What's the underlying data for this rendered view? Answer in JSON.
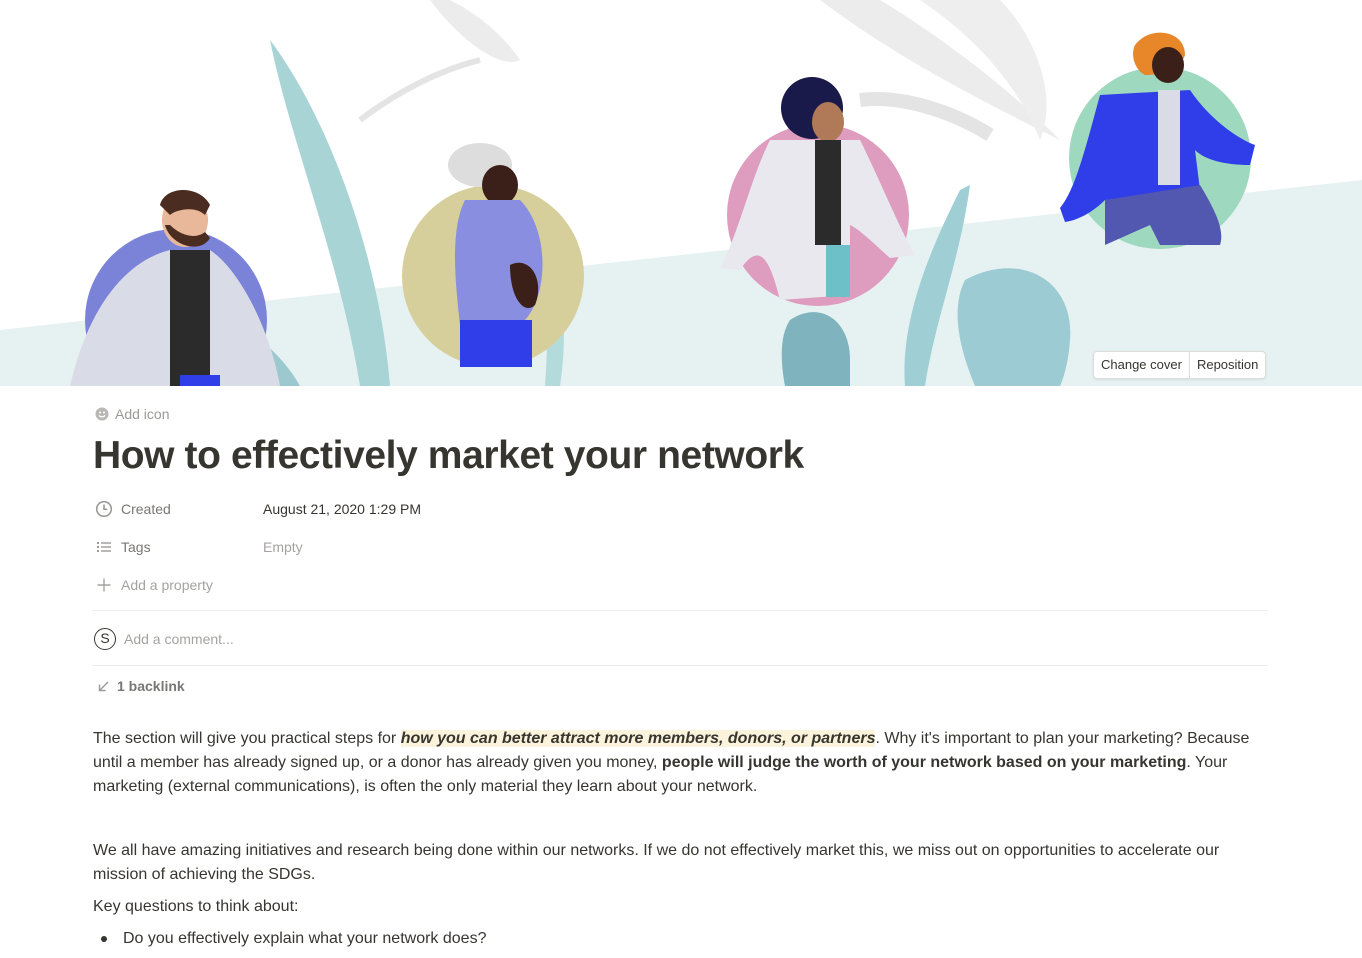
{
  "cover": {
    "change_cover_label": "Change cover",
    "reposition_label": "Reposition"
  },
  "header": {
    "add_icon_label": "Add icon",
    "title": "How to effectively market your network"
  },
  "properties": {
    "created": {
      "label": "Created",
      "value": "August 21, 2020 1:29 PM"
    },
    "tags": {
      "label": "Tags",
      "value": "Empty"
    },
    "add_property_label": "Add a property"
  },
  "comment": {
    "avatar_letter": "S",
    "placeholder": "Add a comment..."
  },
  "backlinks": {
    "label": "1 backlink"
  },
  "content": {
    "p1_part1": "The section will give you practical steps for ",
    "p1_highlight": "how you can better attract more members, donors, or partners",
    "p1_part2": ". Why it's important to plan your marketing? Because until a member has already signed up, or a donor has already given you money, ",
    "p1_bold": "people will judge the worth of your network based on your marketing",
    "p1_part3": ". Your marketing (external communications), is often the only material they learn about your network.",
    "p2": "We all have amazing initiatives and research being done within our networks. If we do not effectively market this, we miss out on opportunities to accelerate our mission of achieving the SDGs.",
    "p3": "Key questions to think about:",
    "bullets": [
      "Do you effectively explain what your network does?"
    ]
  },
  "colors": {
    "text": "#37352f",
    "muted": "#787774",
    "highlight_bg": "#fbf3db",
    "cover_teal": "#a8d4d6",
    "circle_purple": "#7b83d9",
    "circle_khaki": "#d6cf9b",
    "circle_pink": "#de9cbf",
    "circle_green": "#9ed9bf"
  }
}
